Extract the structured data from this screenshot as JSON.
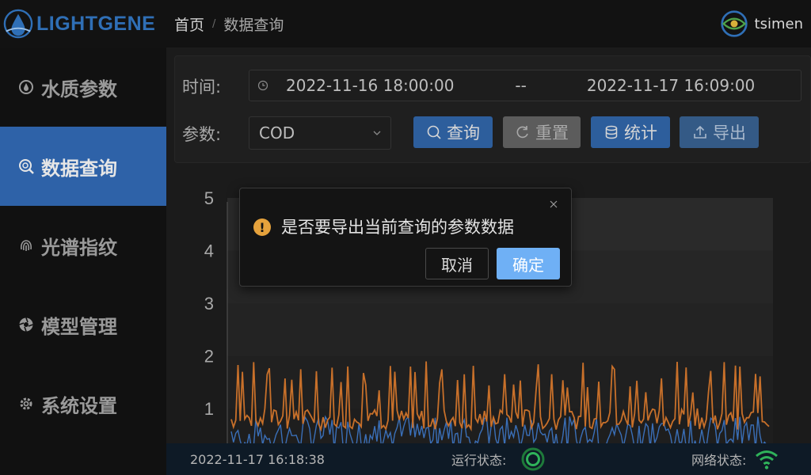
{
  "app": {
    "brand": "LIGHTGENE",
    "brand_color": "#2f6fb6"
  },
  "breadcrumb": {
    "home": "首页",
    "separator": "/",
    "current": "数据查询"
  },
  "user": {
    "name": "tsimen",
    "icon": "eye-logo-icon"
  },
  "sidebar": {
    "items": [
      {
        "label": "水质参数",
        "icon": "water-drop-icon",
        "active": false
      },
      {
        "label": "数据查询",
        "icon": "search-icon",
        "active": true
      },
      {
        "label": "光谱指纹",
        "icon": "fingerprint-icon",
        "active": false
      },
      {
        "label": "模型管理",
        "icon": "aperture-icon",
        "active": false
      },
      {
        "label": "系统设置",
        "icon": "gear-icon",
        "active": false
      }
    ],
    "active_color": "#2e62a8"
  },
  "filter": {
    "time_label": "时间:",
    "start_time": "2022-11-16 18:00:00",
    "range_separator": "--",
    "end_time": "2022-11-17 16:09:00",
    "param_label": "参数:",
    "param_value": "COD",
    "buttons": {
      "query": "查询",
      "reset": "重置",
      "stats": "统计",
      "export": "导出"
    }
  },
  "chart_data": {
    "type": "line",
    "ylim": [
      0,
      5
    ],
    "yticks": [
      "5",
      "4",
      "3",
      "2",
      "1"
    ],
    "series_colors": [
      "#c8702a",
      "#3a6fb8"
    ],
    "grid": true
  },
  "modal": {
    "message": "是否要导出当前查询的参数数据",
    "cancel": "取消",
    "confirm": "确定",
    "icon": "warning-icon"
  },
  "status": {
    "timestamp": "2022-11-17 16:18:38",
    "run_label": "运行状态:",
    "net_label": "网络状态:",
    "run_icon": "running-status-icon",
    "net_icon": "wifi-icon"
  }
}
